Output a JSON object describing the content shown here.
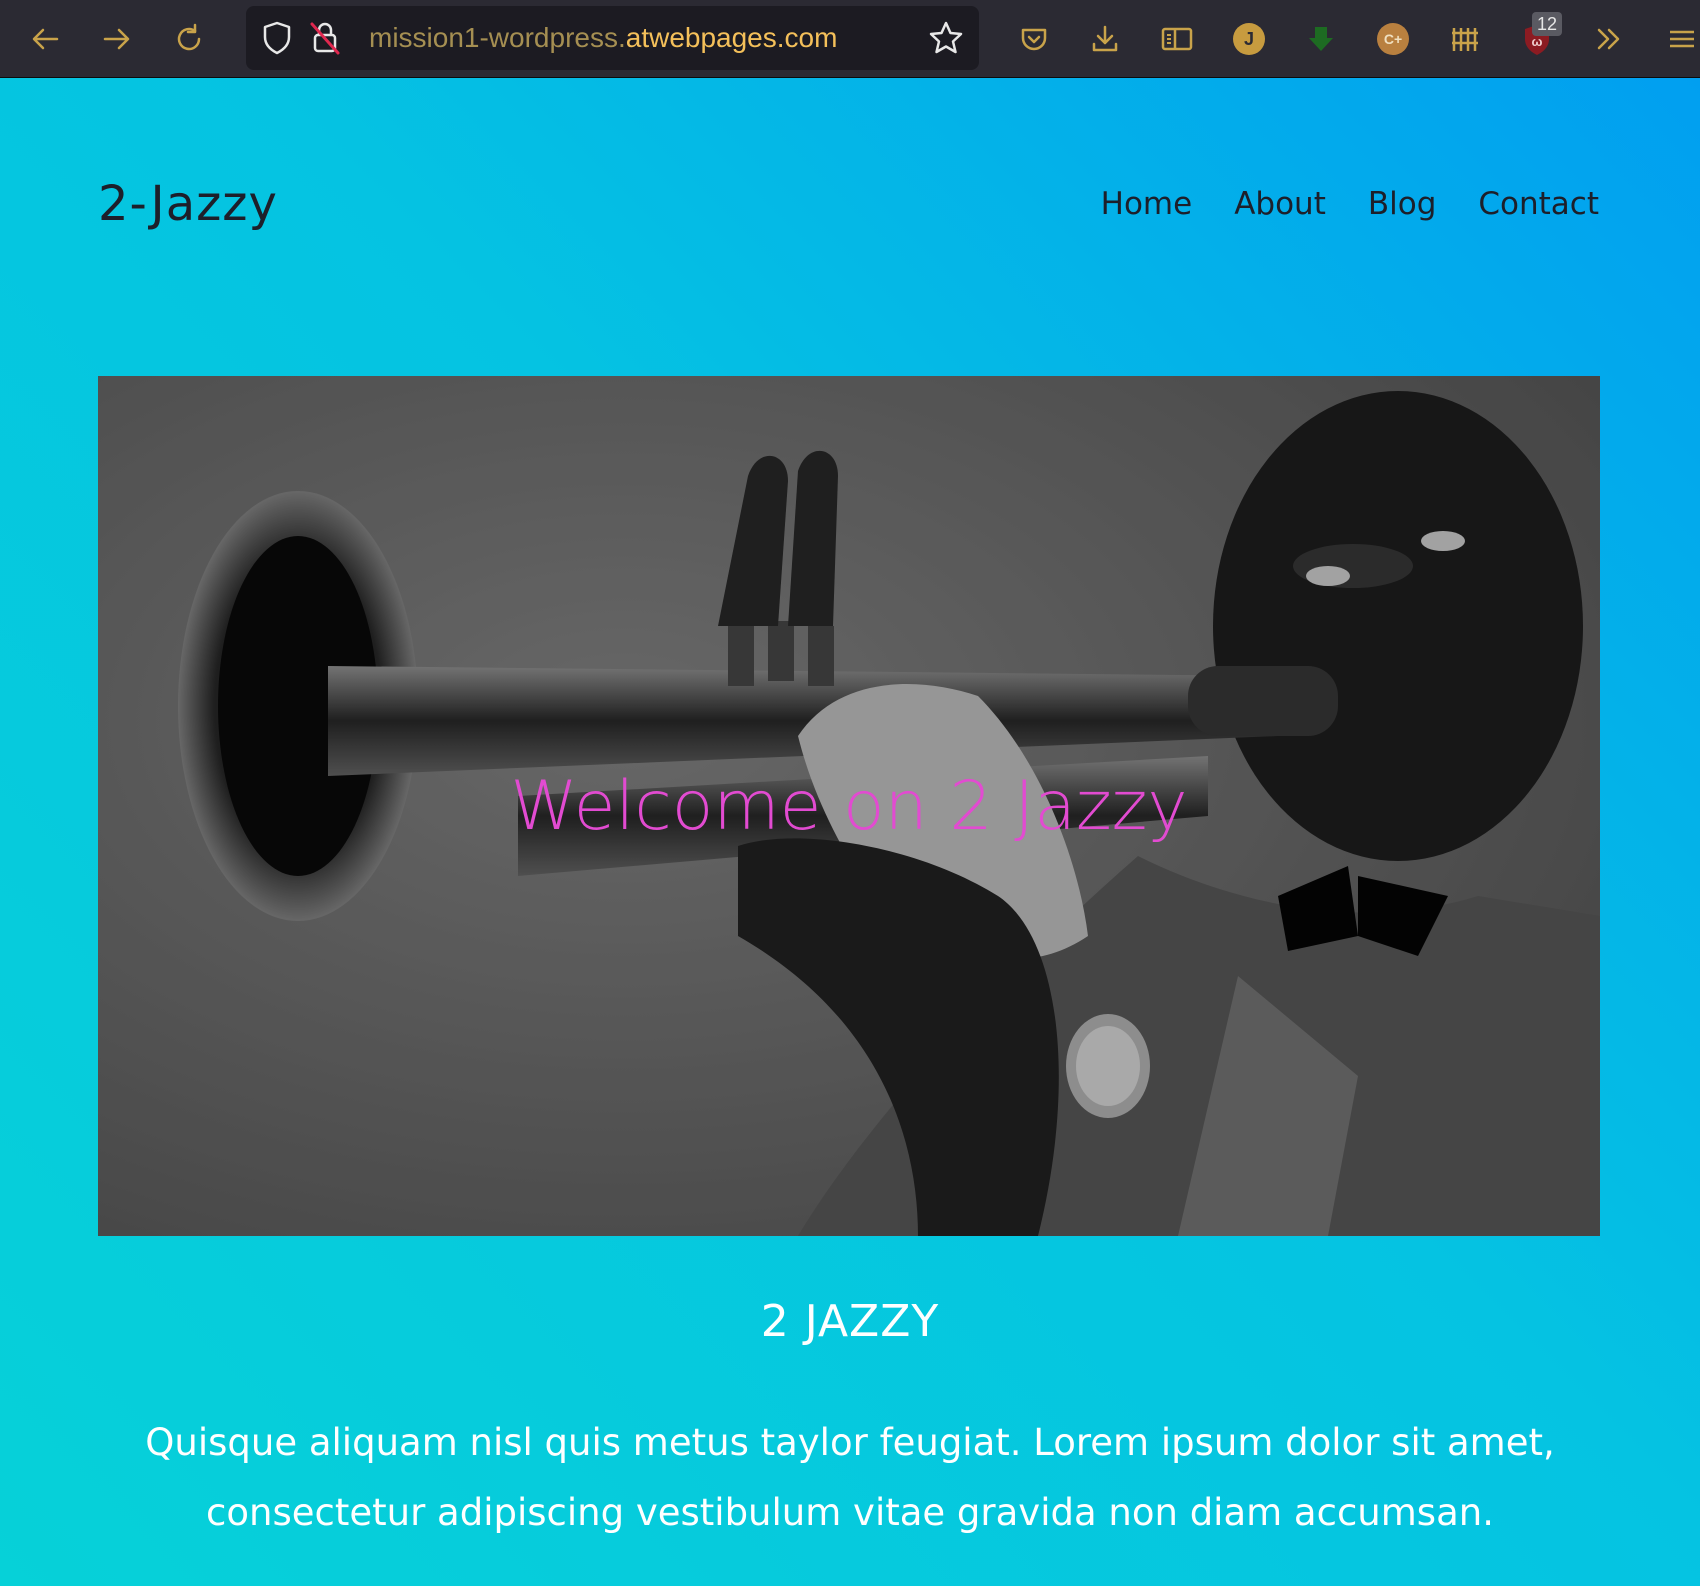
{
  "browser": {
    "url_subdomain": "mission1-wordpress.",
    "url_domain": "atwebpages.com",
    "profile_initial": "J",
    "extension_label": "C+",
    "extension_badge_count": "12",
    "colors": {
      "toolbar_bg": "#2b2a33",
      "urlbar_bg": "#1c1b22",
      "icon_color": "#c9a34a"
    }
  },
  "site": {
    "title": "2-Jazzy",
    "nav": {
      "home": "Home",
      "about": "About",
      "blog": "Blog",
      "contact": "Contact"
    }
  },
  "hero": {
    "heading": "Welcome on 2 Jazzy"
  },
  "section": {
    "heading": "2 JAZZY",
    "body": "Quisque aliquam nisl quis metus taylor feugiat. Lorem ipsum dolor sit amet, consectetur adipiscing vestibulum vitae gravida non diam accumsan."
  },
  "colors": {
    "gradient_start": "#06d1d8",
    "gradient_end": "#019ff0",
    "hero_text": "#e24bd1",
    "title_text": "#1d1f2a"
  }
}
